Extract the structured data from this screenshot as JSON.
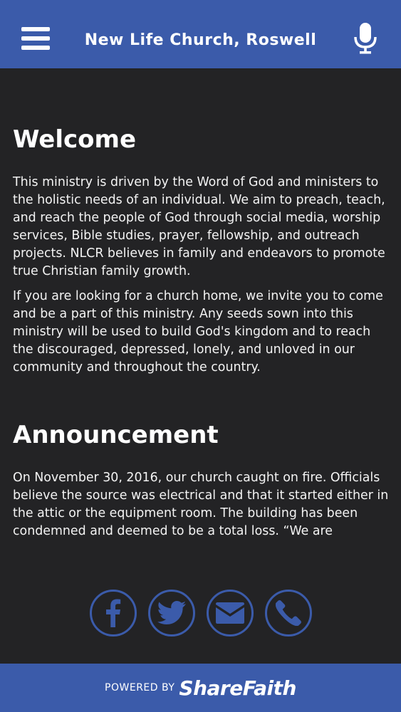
{
  "header": {
    "title": "New Life Church, Roswell",
    "menu_icon": "hamburger-icon",
    "mic_icon": "microphone-icon"
  },
  "welcome": {
    "heading": "Welcome",
    "p1": "This ministry is driven by the Word of God and ministers to the holistic needs of an individual.  We aim to preach, teach, and reach the people of God through social media, worship services, Bible studies, prayer, fellowship, and outreach projects. NLCR believes in family and endeavors to promote true Christian family growth.",
    "p2": "If you are looking for a church home, we invite you to come and be a part of this ministry.  Any seeds sown into this ministry will be used to build God's kingdom and to reach the discouraged, depressed, lonely, and unloved in our community and throughout the country."
  },
  "announcement": {
    "heading": "Announcement",
    "p1": "On November 30, 2016, our church caught on fire.  Officials believe the source was electrical and that it started either in the attic or the equipment room.  The building has been condemned and deemed to be a total loss.  “We are"
  },
  "social": {
    "icons": [
      "facebook-icon",
      "twitter-icon",
      "email-icon",
      "phone-icon"
    ],
    "color": "#3b5baa"
  },
  "footer": {
    "powered_by": "POWERED BY",
    "brand": "ShareFaith"
  },
  "colors": {
    "accent": "#3b5baa",
    "background": "#232325"
  }
}
